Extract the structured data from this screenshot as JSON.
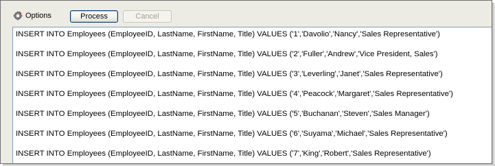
{
  "toolbar": {
    "options_label": "Options",
    "options_icon": "gear-icon",
    "process_label": "Process",
    "cancel_label": "Cancel"
  },
  "content": {
    "lines": [
      "INSERT INTO Employees (EmployeeID, LastName, FirstName, Title) VALUES ('1','Davolio','Nancy','Sales Representative')",
      "INSERT INTO Employees (EmployeeID, LastName, FirstName, Title) VALUES ('2','Fuller','Andrew','Vice President, Sales')",
      "INSERT INTO Employees (EmployeeID, LastName, FirstName, Title) VALUES ('3','Leverling','Janet','Sales Representative')",
      "INSERT INTO Employees (EmployeeID, LastName, FirstName, Title) VALUES ('4','Peacock','Margaret','Sales Representative')",
      "INSERT INTO Employees (EmployeeID, LastName, FirstName, Title) VALUES ('5','Buchanan','Steven','Sales Manager')",
      "INSERT INTO Employees (EmployeeID, LastName, FirstName, Title) VALUES ('6','Suyama','Michael','Sales Representative')",
      "INSERT INTO Employees (EmployeeID, LastName, FirstName, Title) VALUES ('7','King','Robert','Sales Representative')"
    ]
  }
}
